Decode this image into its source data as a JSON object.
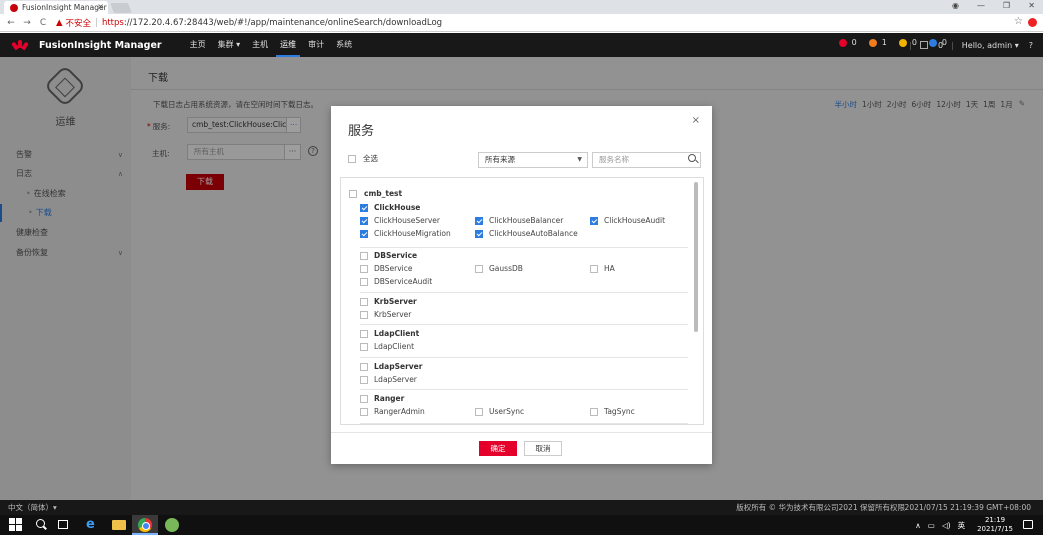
{
  "browser": {
    "tab_title": "FusionInsight Manager",
    "tab_close": "×",
    "insecure_label": "不安全",
    "url_scheme": "https",
    "url_rest": "://172.20.4.67:28443/web/#!/app/maintenance/onlineSearch/downloadLog",
    "back": "←",
    "forward": "→",
    "reload": "C",
    "star": "☆"
  },
  "header": {
    "brand": "FusionInsight Manager",
    "nav": [
      "主页",
      "集群 ▾",
      "主机",
      "运维",
      "审计",
      "系统"
    ],
    "active_nav": "运维",
    "alarms": [
      {
        "count": "0",
        "color": "#e4002b"
      },
      {
        "count": "1",
        "color": "#f07c1d"
      },
      {
        "count": "0",
        "color": "#f0b400"
      },
      {
        "count": "0",
        "color": "#2d7de0"
      }
    ],
    "tasks_count": "0",
    "user": "Hello, admin ▾",
    "help": "?"
  },
  "sidebar": {
    "module": "运维",
    "items": [
      {
        "label": "告警",
        "chev": "∨"
      },
      {
        "label": "日志",
        "chev": "∧"
      },
      {
        "label": "在线检索",
        "chev": ""
      },
      {
        "label": "下载",
        "chev": ""
      },
      {
        "label": "健康检查",
        "chev": ""
      },
      {
        "label": "备份恢复",
        "chev": "∨"
      }
    ]
  },
  "main": {
    "title": "下载",
    "notice": "下载日志占用系统资源，请在空闲时间下载日志。",
    "time_options": [
      "半小时",
      "1小时",
      "2小时",
      "6小时",
      "12小时",
      "1天",
      "1周",
      "1月"
    ],
    "active_time": "半小时",
    "service_label": "服务:",
    "service_value": "cmb_test:ClickHouse:ClickHouseServer",
    "host_label": "主机:",
    "host_placeholder": "所有主机",
    "host_pick": "···",
    "help": "?",
    "download_button": "下载"
  },
  "modal": {
    "title": "服务",
    "close": "×",
    "select_all": "全选",
    "source_select": "所有来源",
    "search_placeholder": "服务名称",
    "cluster": "cmb_test",
    "services": [
      {
        "name": "ClickHouse",
        "checked": true,
        "roles": [
          {
            "name": "ClickHouseServer",
            "checked": true
          },
          {
            "name": "ClickHouseBalancer",
            "checked": true
          },
          {
            "name": "ClickHouseAudit",
            "checked": true
          },
          {
            "name": "ClickHouseMigration",
            "checked": true
          },
          {
            "name": "ClickHouseAutoBalance",
            "checked": true
          }
        ]
      },
      {
        "name": "DBService",
        "checked": false,
        "roles": [
          {
            "name": "DBService",
            "checked": false
          },
          {
            "name": "GaussDB",
            "checked": false
          },
          {
            "name": "HA",
            "checked": false
          },
          {
            "name": "DBServiceAudit",
            "checked": false
          }
        ]
      },
      {
        "name": "KrbServer",
        "checked": false,
        "roles": [
          {
            "name": "KrbServer",
            "checked": false
          }
        ]
      },
      {
        "name": "LdapClient",
        "checked": false,
        "roles": [
          {
            "name": "LdapClient",
            "checked": false
          }
        ]
      },
      {
        "name": "LdapServer",
        "checked": false,
        "roles": [
          {
            "name": "LdapServer",
            "checked": false
          }
        ]
      },
      {
        "name": "Ranger",
        "checked": false,
        "roles": [
          {
            "name": "RangerAdmin",
            "checked": false
          },
          {
            "name": "UserSync",
            "checked": false
          },
          {
            "name": "TagSync",
            "checked": false
          }
        ]
      }
    ],
    "ok": "确定",
    "cancel": "取消"
  },
  "footer": {
    "language": "中文（简体）▾",
    "copyright": "版权所有 © 华为技术有限公司2021 保留所有权限",
    "datetime": "2021/07/15 21:19:39 GMT+08:00"
  },
  "taskbar": {
    "ie": "e",
    "ime": "英",
    "time": "21:19",
    "date": "2021/7/15"
  }
}
